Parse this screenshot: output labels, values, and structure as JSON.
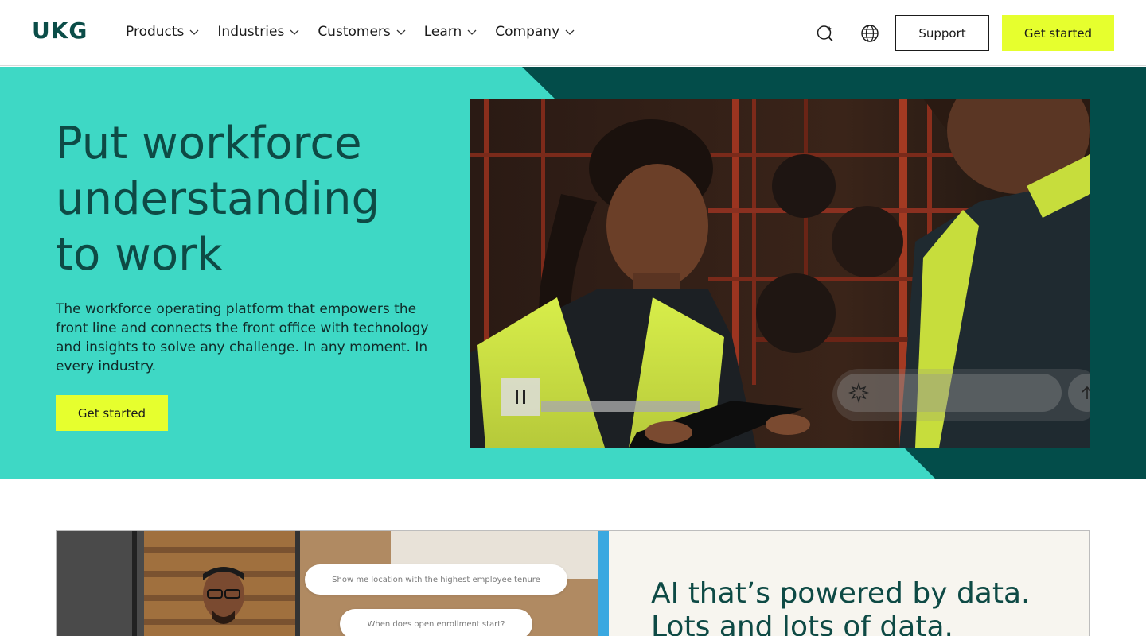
{
  "header": {
    "logo": "UKG",
    "nav": [
      {
        "label": "Products"
      },
      {
        "label": "Industries"
      },
      {
        "label": "Customers"
      },
      {
        "label": "Learn"
      },
      {
        "label": "Company"
      }
    ],
    "icons": [
      "search-icon",
      "globe-icon"
    ],
    "support_label": "Support",
    "get_started_label": "Get started"
  },
  "hero": {
    "title": "Put workforce understanding to work",
    "description": "The workforce operating platform that empowers the front line and connects the front office with technology and insights to solve any challenge. In any moment. In every industry.",
    "cta_label": "Get started",
    "video_controls": {
      "pause_icon": "pause-icon"
    },
    "chat": {
      "spark_icon": "sparkle-icon",
      "send_icon": "arrow-up-icon"
    }
  },
  "feature": {
    "bubbles": [
      "Show me location with the highest employee tenure",
      "When does open enrollment start?"
    ],
    "title": "AI that’s powered by data. Lots and lots of data."
  },
  "colors": {
    "hero_teal": "#3ed8c5",
    "hero_dark": "#034d4a",
    "accent_yellow": "#e6ff2e",
    "heading_green": "#0e4a45"
  }
}
